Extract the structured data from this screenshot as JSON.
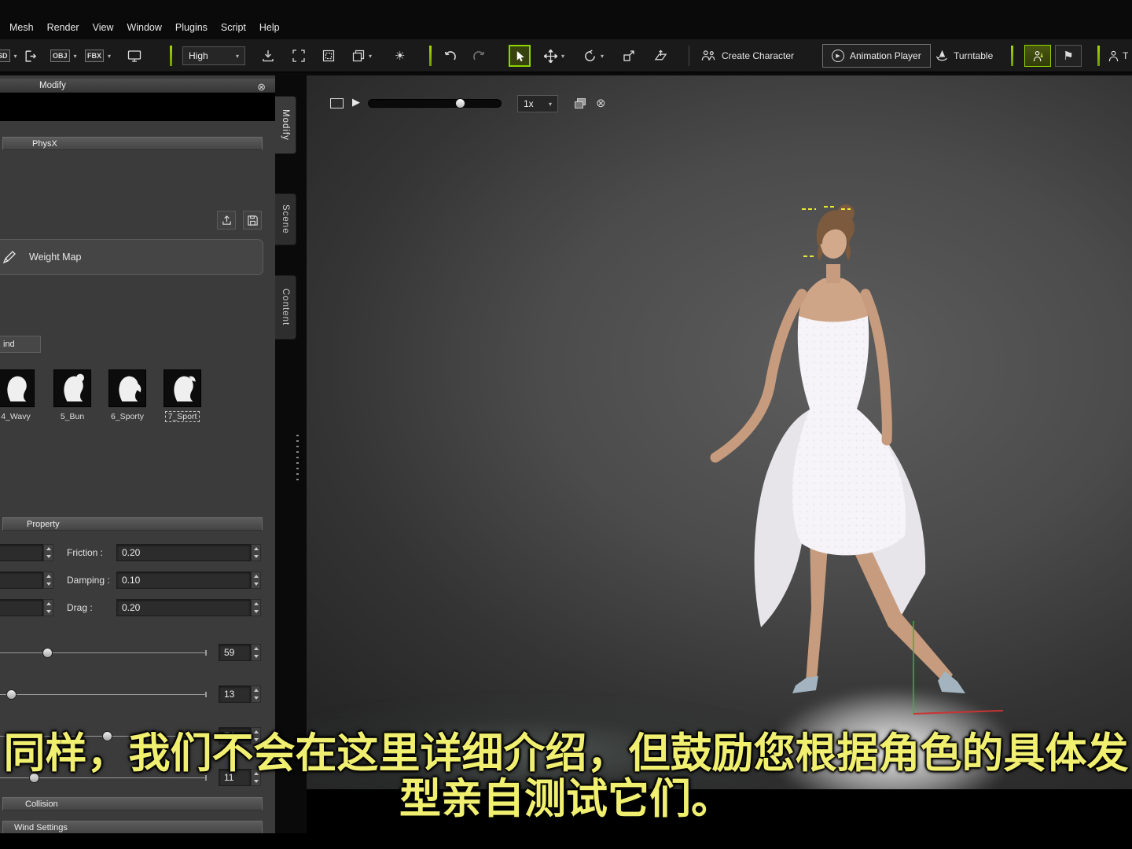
{
  "menubar": {
    "items": [
      {
        "label": "Mesh"
      },
      {
        "label": "Render"
      },
      {
        "label": "View"
      },
      {
        "label": "Window"
      },
      {
        "label": "Plugins"
      },
      {
        "label": "Script"
      },
      {
        "label": "Help"
      }
    ]
  },
  "toolbar": {
    "usd_label": "SD",
    "obj_label": "OBJ",
    "fbx_label": "FBX",
    "quality_value": "High",
    "create_character_label": "Create Character",
    "animation_player_label": "Animation Player",
    "turntable_label": "Turntable",
    "right_truncated_label": "T"
  },
  "panel": {
    "title": "Modify",
    "physx_header": "PhysX",
    "weight_map_label": "Weight Map",
    "wind_tab_label": "ind",
    "hair_items": [
      {
        "label": "4_Wavy"
      },
      {
        "label": "5_Bun"
      },
      {
        "label": "6_Sporty"
      },
      {
        "label": "7_Sport"
      }
    ],
    "property_header": "Property",
    "properties": [
      {
        "label": "Friction :",
        "value": "0.20"
      },
      {
        "label": "Damping :",
        "value": "0.10"
      },
      {
        "label": "Drag :",
        "value": "0.20"
      }
    ],
    "sliders": [
      {
        "value": "59"
      },
      {
        "value": "13"
      },
      {
        "value": "74"
      },
      {
        "value": "11"
      }
    ],
    "collision_header": "Collision",
    "wind_settings_header": "Wind Settings"
  },
  "side_tabs": [
    {
      "label": "Modify"
    },
    {
      "label": "Scene"
    },
    {
      "label": "Content"
    }
  ],
  "viewport": {
    "playback_speed": "1x"
  },
  "subtitles": {
    "line1": "同样，我们不会在这里详细介绍，但鼓励您根据角色的具体发",
    "line2": "型亲自测试它们。"
  },
  "icons": {
    "caret": "▾",
    "play": "▶",
    "sun": "☀",
    "flag": "⚑",
    "close": "⊗",
    "circle_x": "⊗"
  },
  "colors": {
    "accent_green": "#7ab800",
    "subtitle_yellow": "#f1ef70"
  }
}
